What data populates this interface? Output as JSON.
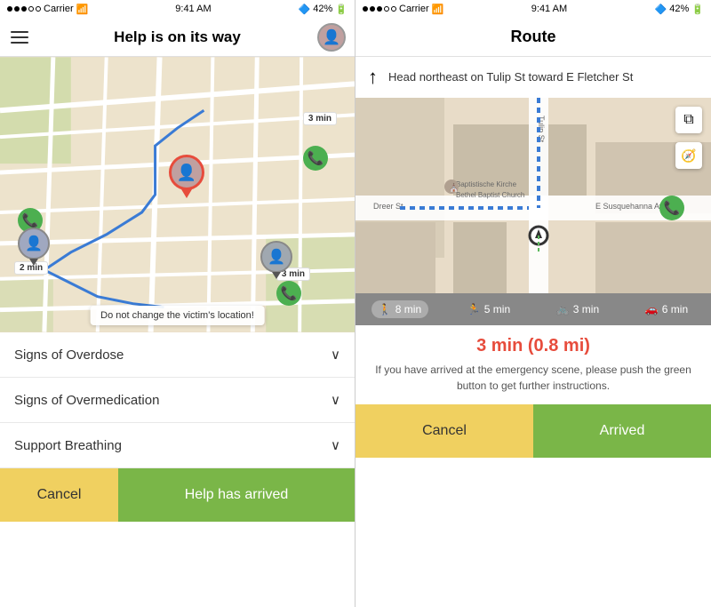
{
  "left_phone": {
    "status_bar": {
      "carrier": "Carrier",
      "time": "9:41 AM",
      "battery": "42%"
    },
    "header": {
      "title": "Help is on its way"
    },
    "map": {
      "victim_banner": "Do not change the victim's location!",
      "pins": [
        {
          "label": "2 min",
          "type": "helper"
        },
        {
          "label": "3 min",
          "type": "helper"
        },
        {
          "label": "3 min",
          "type": "helper"
        }
      ]
    },
    "accordion": {
      "items": [
        {
          "label": "Signs of Overdose"
        },
        {
          "label": "Signs of Overmedication"
        },
        {
          "label": "Support Breathing"
        }
      ]
    },
    "buttons": {
      "cancel": "Cancel",
      "arrived": "Help has arrived"
    }
  },
  "right_phone": {
    "status_bar": {
      "carrier": "Carrier",
      "time": "9:41 AM",
      "battery": "42%"
    },
    "header": {
      "title": "Route"
    },
    "navigation": {
      "instruction": "Head northeast on Tulip St toward E Fletcher St"
    },
    "map": {
      "labels": [
        "Baptistische Kirche",
        "Bethel Baptist Church",
        "E Susquehanna Ave",
        "Dreer St"
      ]
    },
    "travel_modes": [
      {
        "icon": "🚶",
        "label": "8 min",
        "active": true
      },
      {
        "icon": "🏃",
        "label": "5 min",
        "active": false
      },
      {
        "icon": "🚲",
        "label": "3 min",
        "active": false
      },
      {
        "icon": "🚗",
        "label": "6 min",
        "active": false
      }
    ],
    "eta": {
      "time": "3 min (0.8 mi)",
      "description": "If you have arrived at the emergency scene, please push the green button to get further instructions."
    },
    "buttons": {
      "cancel": "Cancel",
      "arrived": "Arrived"
    }
  }
}
